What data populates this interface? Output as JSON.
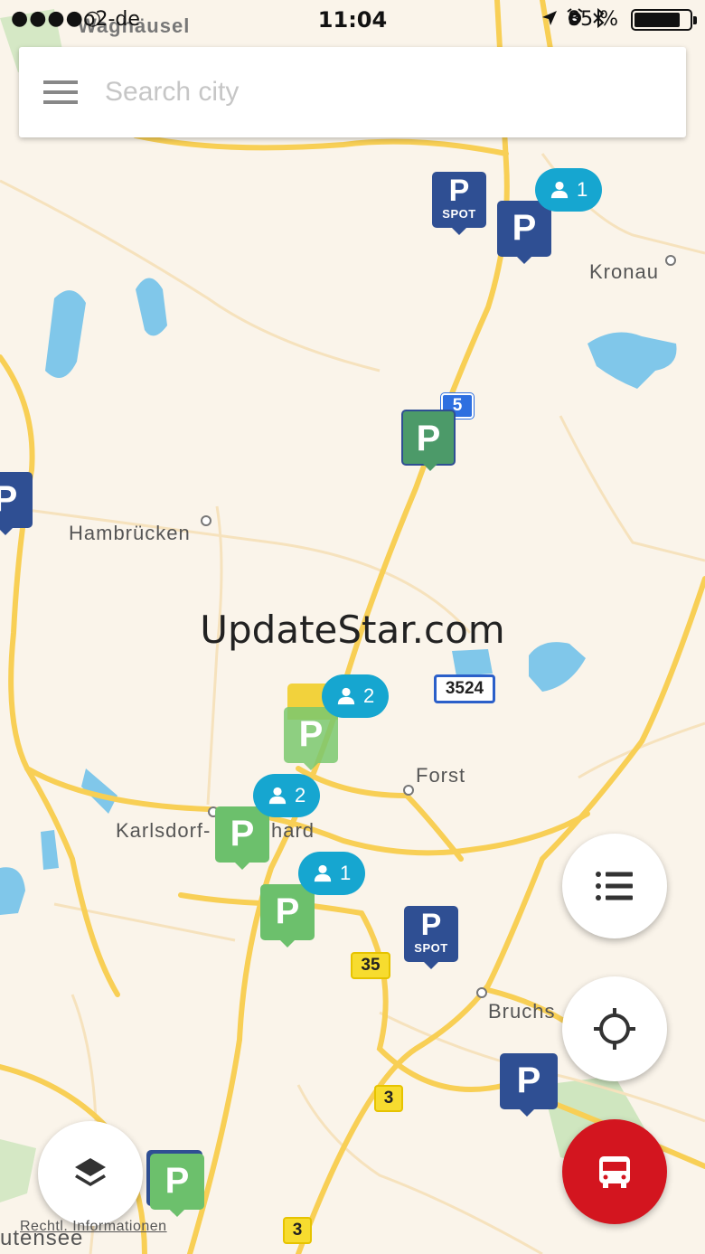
{
  "status_bar": {
    "signal": "●●●●○",
    "carrier": "o2-de",
    "time": "11:04",
    "battery_text": "85 %",
    "battery_level": 0.85
  },
  "search": {
    "placeholder": "Search city",
    "value": ""
  },
  "map": {
    "places": {
      "waghaeusel": "Waghäusel",
      "kronau": "Kronau",
      "hambruecken": "Hambrücken",
      "forst": "Forst",
      "karlsdorf": "Karlsdorf-",
      "karlsdorf_tail": "hard",
      "bruchsal": "Bruchs",
      "stutensee": "utensee"
    },
    "road_signs": {
      "a5": "5",
      "l3524": "3524",
      "b35": "35",
      "b3_top": "3",
      "b3_bottom": "3"
    },
    "pins": {
      "parking_label": "P",
      "spot_label": "SPOT"
    },
    "bubbles": {
      "north": "1",
      "centre": "2",
      "karlsdorf": "2",
      "south": "1"
    },
    "colors": {
      "pin_blue": "#2f4f93",
      "pin_green": "#6cc06c",
      "bubble": "#16a6d0",
      "road": "#f8cf55",
      "water": "#80c7ea"
    }
  },
  "watermark": "UpdateStar.com",
  "legal_link": "Rechtl. Informationen",
  "buttons": {
    "list_icon": "list-icon",
    "locate_icon": "crosshair-icon",
    "layers_icon": "layers-icon",
    "transport_icon": "bus-icon"
  }
}
